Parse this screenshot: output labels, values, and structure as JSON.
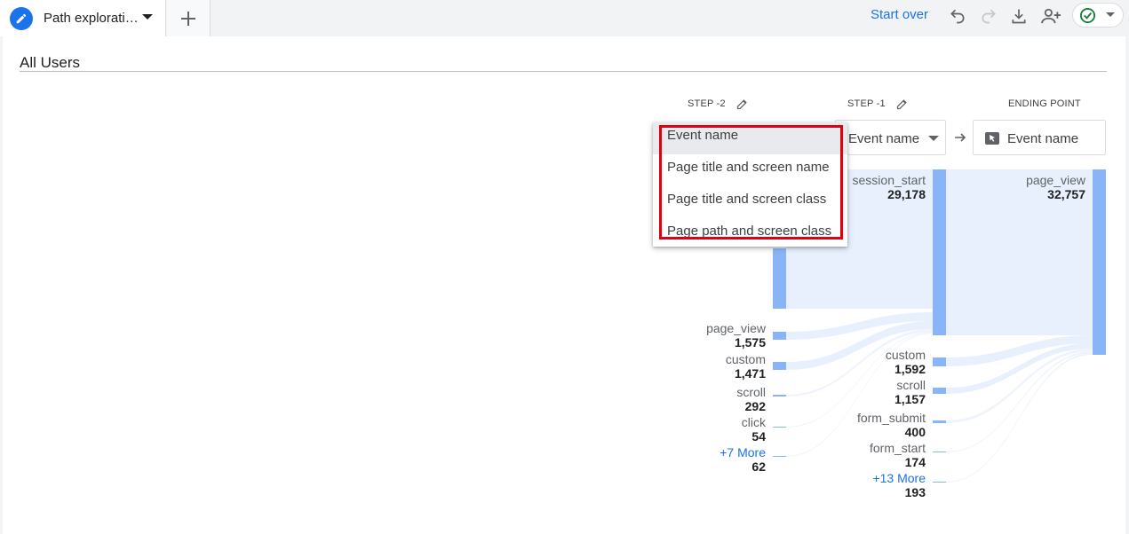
{
  "tab": {
    "title": "Path explorati…",
    "add_tab_label": "+"
  },
  "toolbar": {
    "start_over": "Start over"
  },
  "segment": {
    "name": "All Users"
  },
  "steps": {
    "step_minus_2": {
      "header": "STEP -2"
    },
    "step_minus_1": {
      "header": "STEP -1",
      "selector": "Event name"
    },
    "ending_point": {
      "header": "ENDING POINT",
      "selector": "Event name"
    }
  },
  "dropdown": {
    "options": [
      "Event name",
      "Page title and screen name",
      "Page title and screen class",
      "Page path and screen class"
    ],
    "selected_index": 0
  },
  "nodes": {
    "step_minus_2": [
      {
        "label": "page_view",
        "value": "1,575"
      },
      {
        "label": "custom",
        "value": "1,471"
      },
      {
        "label": "scroll",
        "value": "292"
      },
      {
        "label": "click",
        "value": "54"
      },
      {
        "label": "+7 More",
        "value": "62"
      }
    ],
    "step_minus_1": [
      {
        "label": "session_start",
        "value": "29,178"
      },
      {
        "label": "custom",
        "value": "1,592"
      },
      {
        "label": "scroll",
        "value": "1,157"
      },
      {
        "label": "form_submit",
        "value": "400"
      },
      {
        "label": "form_start",
        "value": "174"
      },
      {
        "label": "+13 More",
        "value": "193"
      }
    ],
    "ending_point": [
      {
        "label": "page_view",
        "value": "32,757"
      }
    ]
  },
  "colors": {
    "accent": "#1a73e8",
    "bar": "#8ab4f8",
    "flow": "#e8f0fe",
    "highlight": "#e0000f",
    "success": "#188038"
  },
  "icons": {
    "tab": "pencil-icon",
    "undo": "undo-icon",
    "redo": "redo-icon",
    "download": "download-icon",
    "share": "person-add-icon",
    "status": "check-circle-icon"
  }
}
